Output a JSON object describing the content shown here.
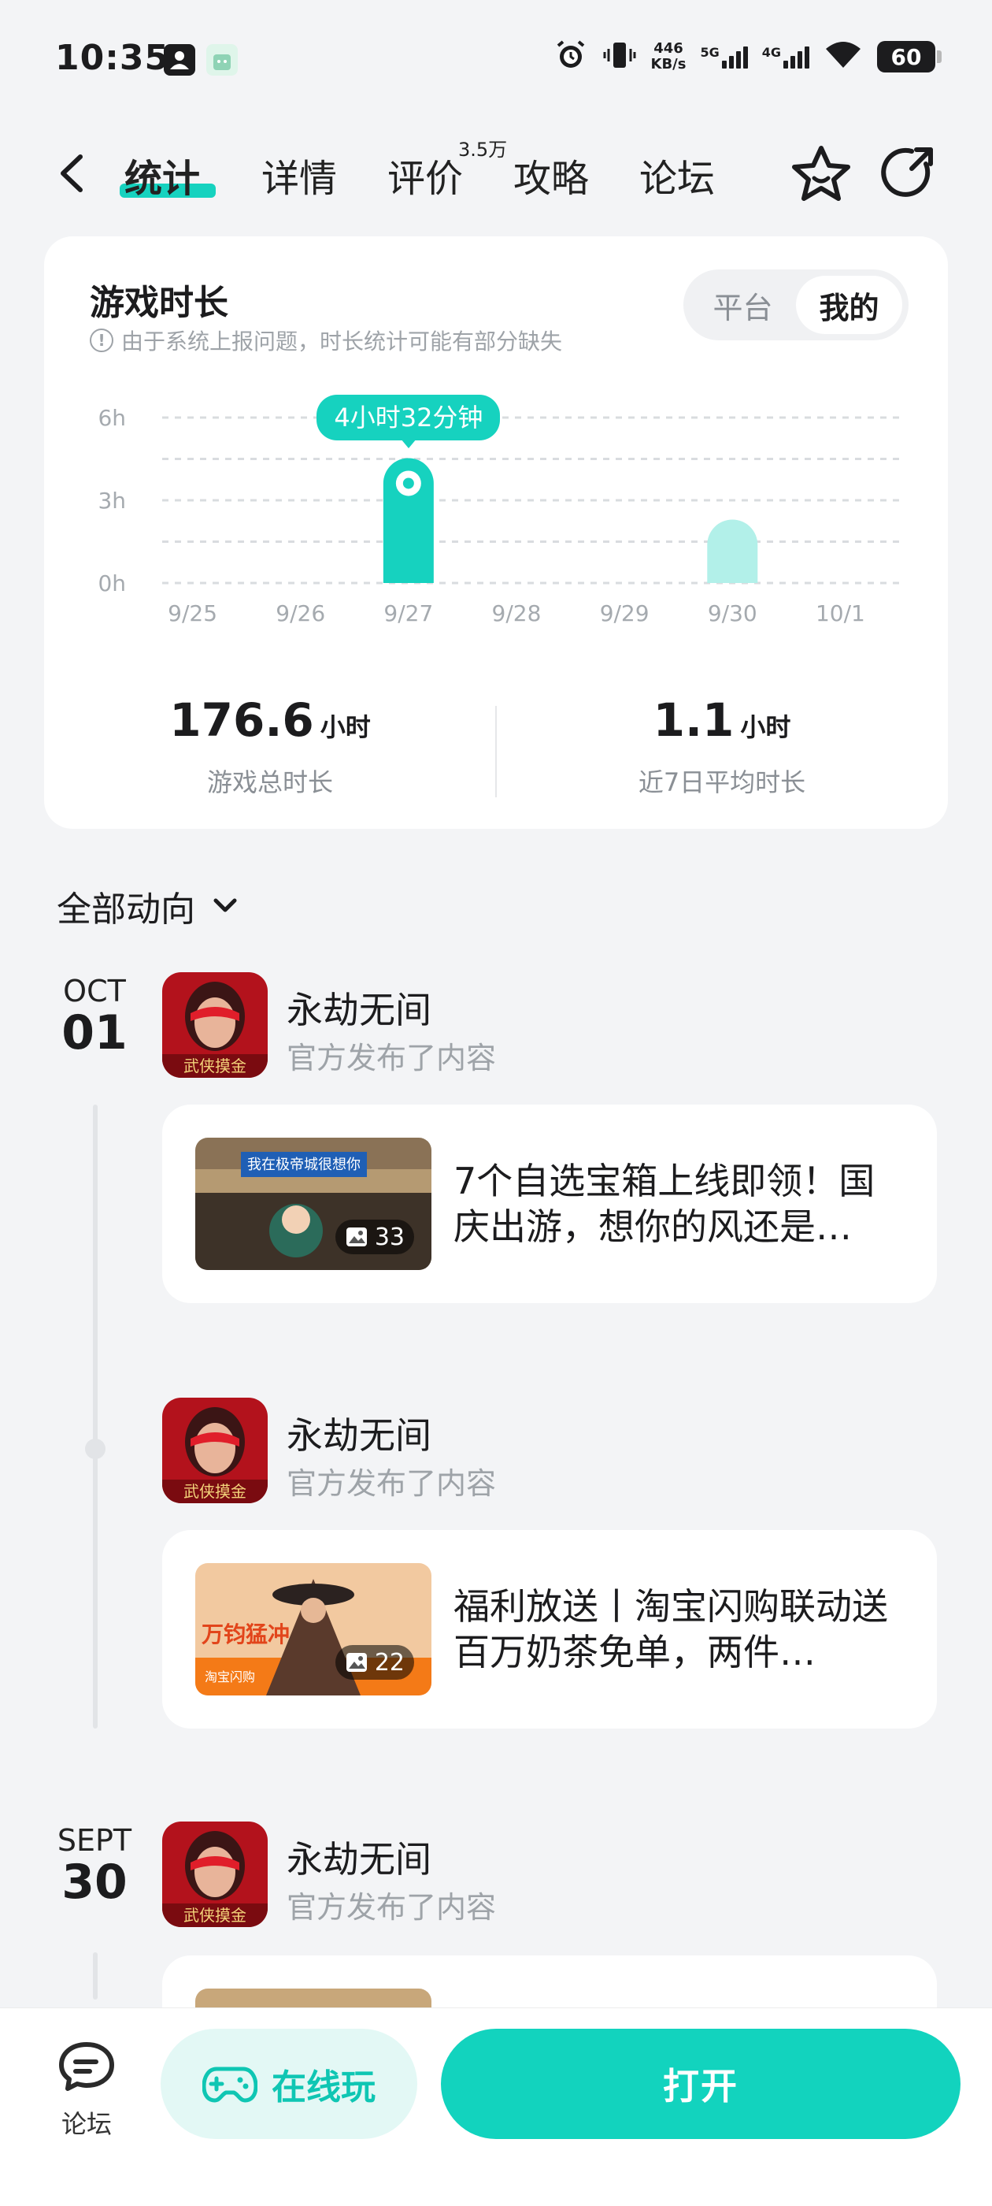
{
  "status_bar": {
    "time": "10:35",
    "net_speed_value": "446",
    "net_speed_unit": "KB/s",
    "sim1_type": "5G",
    "sim2_type": "4G",
    "battery": "60"
  },
  "nav": {
    "tabs": [
      {
        "label": "统计",
        "active": true
      },
      {
        "label": "详情",
        "active": false
      },
      {
        "label": "评价",
        "active": false,
        "badge": "3.5万"
      },
      {
        "label": "攻略",
        "active": false
      },
      {
        "label": "论坛",
        "active": false
      }
    ],
    "accent_color": "#16d2bf"
  },
  "stats_card": {
    "title": "游戏时长",
    "note": "由于系统上报问题，时长统计可能有部分缺失",
    "toggle": {
      "options": [
        "平台",
        "我的"
      ],
      "selected": "我的"
    },
    "total": {
      "value": "176.6",
      "unit": "小时",
      "label": "游戏总时长"
    },
    "average": {
      "value": "1.1",
      "unit": "小时",
      "label": "近7日平均时长"
    }
  },
  "chart_data": {
    "type": "bar",
    "title": "游戏时长",
    "categories": [
      "9/25",
      "9/26",
      "9/27",
      "9/28",
      "9/29",
      "9/30",
      "10/1"
    ],
    "values": [
      0,
      0,
      4.53,
      0,
      0,
      2.3,
      0
    ],
    "y_ticks": [
      "0h",
      "3h",
      "6h"
    ],
    "ylim": [
      0,
      6
    ],
    "grid": true,
    "highlighted_index": 2,
    "highlight_label": "4小时32分钟",
    "bar_color": "#16d2bf",
    "bar_color_muted": "#b2f0e9"
  },
  "feed": {
    "filter_label": "全部动向",
    "groups": [
      {
        "month": "OCT",
        "day": "01",
        "posts": [
          {
            "author": "永劫无间",
            "action": "官方发布了内容",
            "text": "7个自选宝箱上线即领！国庆出游，想你的风还是…",
            "image_count": "33"
          },
          {
            "author": "永劫无间",
            "action": "官方发布了内容",
            "text": "福利放送丨淘宝闪购联动送百万奶茶免单，两件…",
            "image_count": "22"
          }
        ]
      },
      {
        "month": "SEPT",
        "day": "30",
        "posts": [
          {
            "author": "永劫无间",
            "action": "官方发布了内容"
          }
        ]
      }
    ],
    "avatar_badge": "武侠摸金",
    "thumb1_caption": "我在极帝城很想你",
    "thumb2_caption": "万钧猛冲",
    "thumb2_brand": "淘宝闪购"
  },
  "bottom_bar": {
    "forum_label": "论坛",
    "play_online_label": "在线玩",
    "open_label": "打开"
  }
}
